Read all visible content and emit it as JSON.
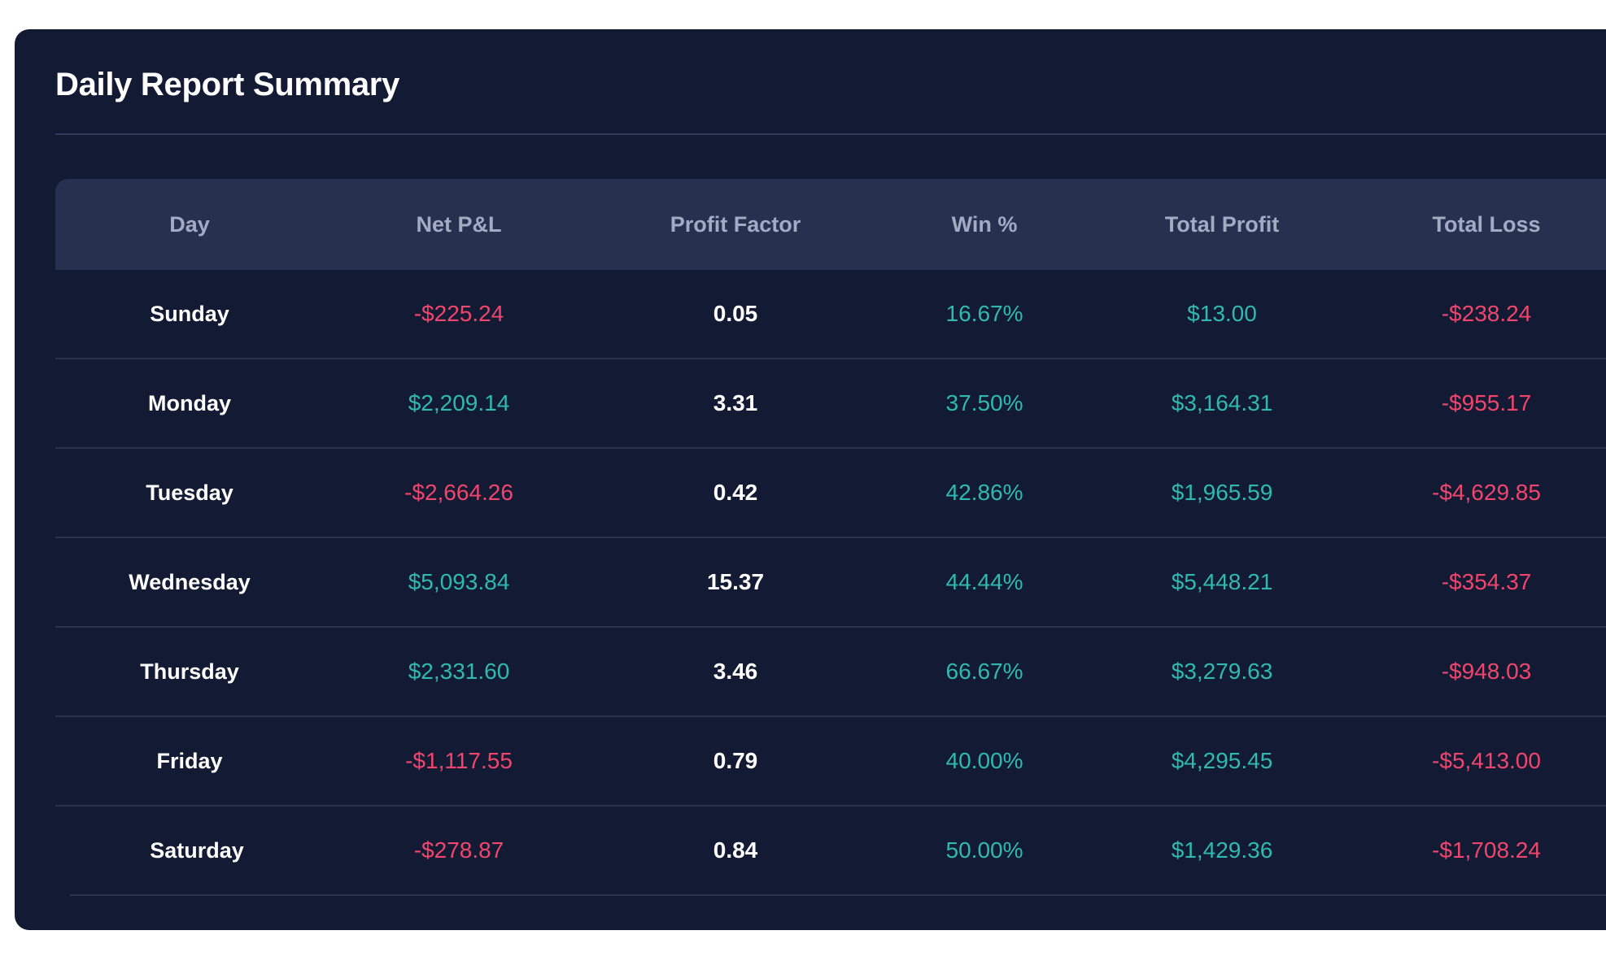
{
  "title": "Daily Report Summary",
  "colors": {
    "card_background": "#131a34",
    "header_background": "#283050",
    "positive": "#2fb9b0",
    "negative": "#f0466c",
    "text": "#ffffff"
  },
  "columns": [
    "Day",
    "Net P&L",
    "Profit Factor",
    "Win %",
    "Total Profit",
    "Total Loss"
  ],
  "rows": [
    {
      "day": "Sunday",
      "net_pnl": "-$225.24",
      "profit_factor": "0.05",
      "win_pct": "16.67%",
      "total_profit": "$13.00",
      "total_loss": "-$238.24"
    },
    {
      "day": "Monday",
      "net_pnl": "$2,209.14",
      "profit_factor": "3.31",
      "win_pct": "37.50%",
      "total_profit": "$3,164.31",
      "total_loss": "-$955.17"
    },
    {
      "day": "Tuesday",
      "net_pnl": "-$2,664.26",
      "profit_factor": "0.42",
      "win_pct": "42.86%",
      "total_profit": "$1,965.59",
      "total_loss": "-$4,629.85"
    },
    {
      "day": "Wednesday",
      "net_pnl": "$5,093.84",
      "profit_factor": "15.37",
      "win_pct": "44.44%",
      "total_profit": "$5,448.21",
      "total_loss": "-$354.37"
    },
    {
      "day": "Thursday",
      "net_pnl": "$2,331.60",
      "profit_factor": "3.46",
      "win_pct": "66.67%",
      "total_profit": "$3,279.63",
      "total_loss": "-$948.03"
    },
    {
      "day": "Friday",
      "net_pnl": "-$1,117.55",
      "profit_factor": "0.79",
      "win_pct": "40.00%",
      "total_profit": "$4,295.45",
      "total_loss": "-$5,413.00"
    },
    {
      "day": "Saturday",
      "net_pnl": "-$278.87",
      "profit_factor": "0.84",
      "win_pct": "50.00%",
      "total_profit": "$1,429.36",
      "total_loss": "-$1,708.24"
    }
  ]
}
